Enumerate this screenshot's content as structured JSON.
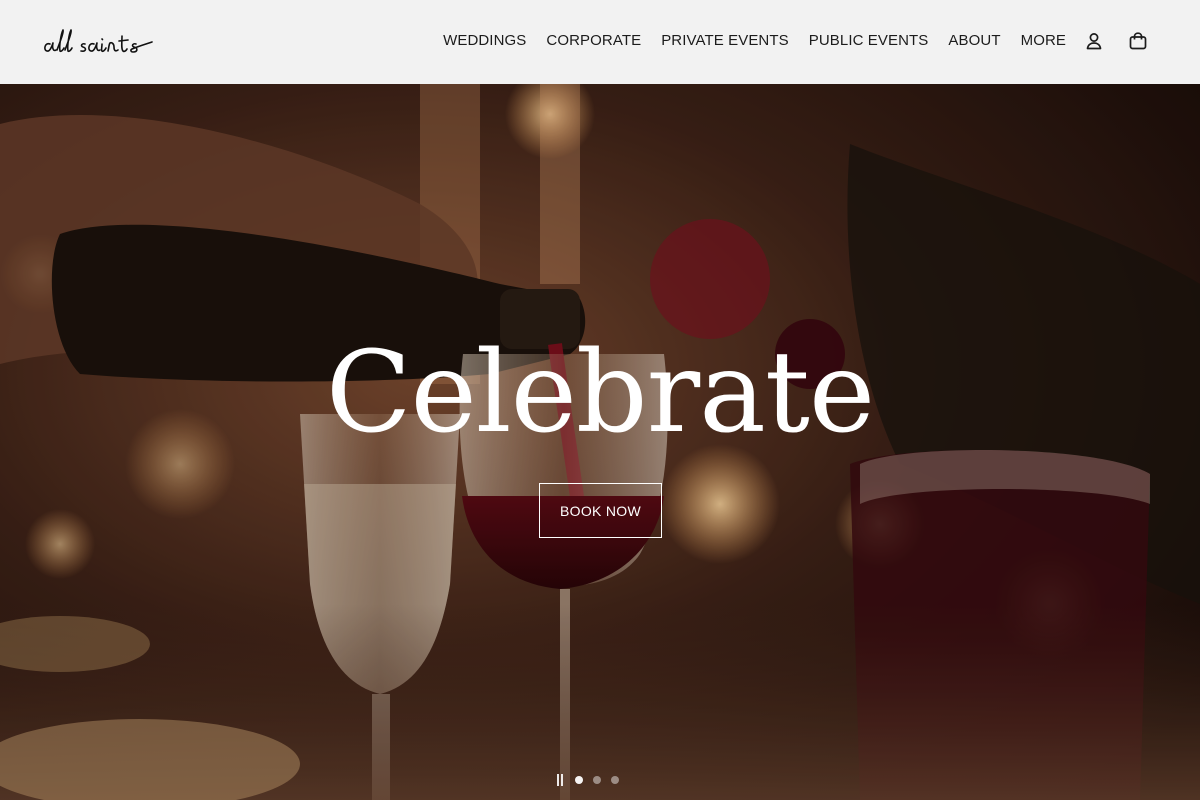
{
  "header": {
    "logo_text": "all saints",
    "nav": [
      {
        "label": "WEDDINGS"
      },
      {
        "label": "CORPORATE"
      },
      {
        "label": "PRIVATE EVENTS"
      },
      {
        "label": "PUBLIC EVENTS"
      },
      {
        "label": "ABOUT"
      },
      {
        "label": "MORE"
      }
    ],
    "account_icon": "person-icon",
    "cart_icon": "shopping-bag-icon"
  },
  "hero": {
    "headline": "Celebrate",
    "cta_label": "BOOK NOW",
    "slides_total": 3,
    "active_slide": 1,
    "pause_icon": "pause-icon"
  },
  "colors": {
    "header_bg": "#f2f2f2",
    "text_dark": "#1c1c1c",
    "hero_text": "#ffffff"
  }
}
